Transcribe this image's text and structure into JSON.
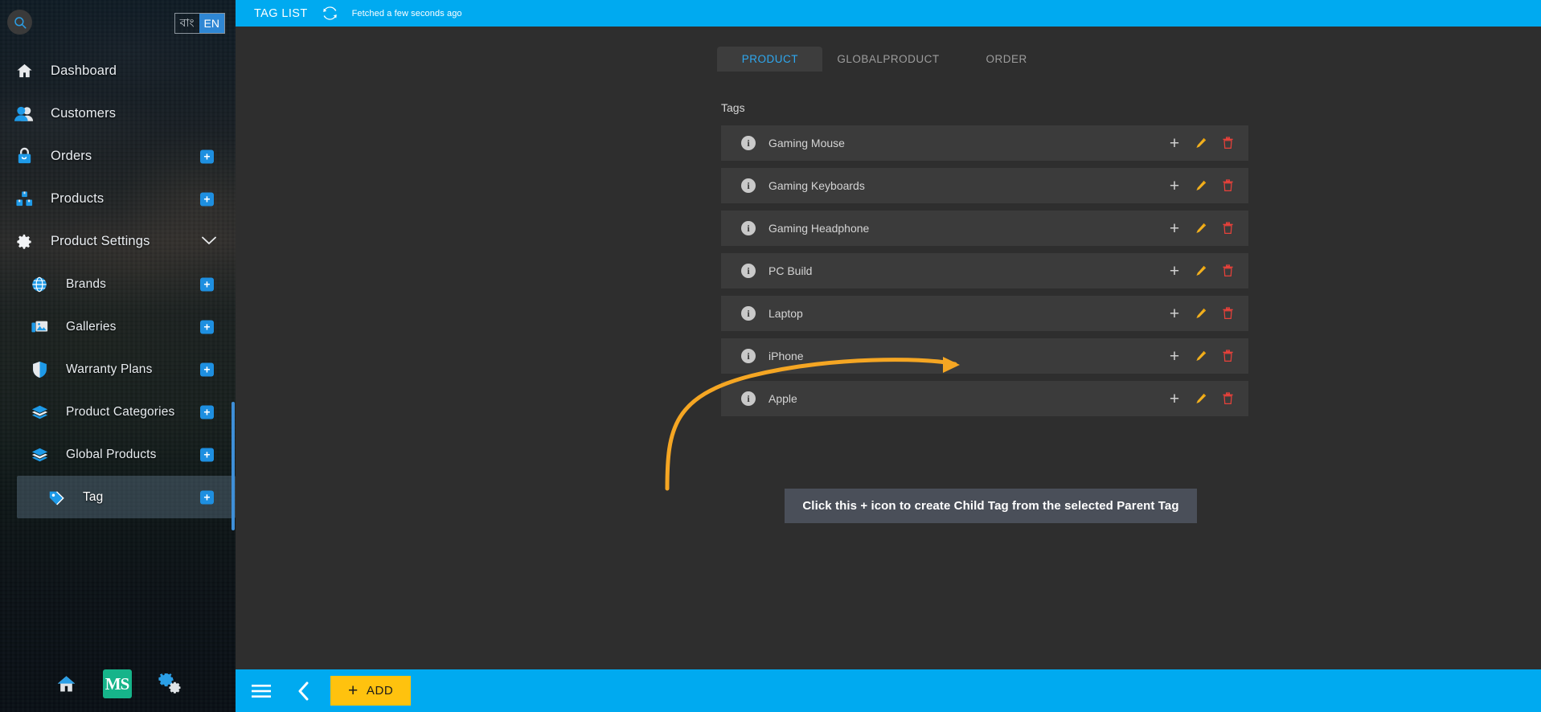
{
  "sidebar": {
    "search_icon": "search-icon",
    "language": {
      "options": [
        {
          "label": "বাং",
          "active": false
        },
        {
          "label": "EN",
          "active": true
        }
      ]
    },
    "items": [
      {
        "label": "Dashboard",
        "icon": "home-icon",
        "sub": false,
        "badge": null,
        "chevron": false,
        "active": false
      },
      {
        "label": "Customers",
        "icon": "users-icon",
        "sub": false,
        "badge": null,
        "chevron": false,
        "active": false
      },
      {
        "label": "Orders",
        "icon": "bag-icon",
        "sub": false,
        "badge": "+",
        "chevron": false,
        "active": false
      },
      {
        "label": "Products",
        "icon": "boxes-icon",
        "sub": false,
        "badge": "+",
        "chevron": false,
        "active": false
      },
      {
        "label": "Product Settings",
        "icon": "gear-icon",
        "sub": false,
        "badge": null,
        "chevron": true,
        "active": false
      },
      {
        "label": "Brands",
        "icon": "globe-icon",
        "sub": true,
        "badge": "+",
        "chevron": false,
        "active": false
      },
      {
        "label": "Galleries",
        "icon": "image-icon",
        "sub": true,
        "badge": "+",
        "chevron": false,
        "active": false
      },
      {
        "label": "Warranty Plans",
        "icon": "shield-icon",
        "sub": true,
        "badge": "+",
        "chevron": false,
        "active": false
      },
      {
        "label": "Product Categories",
        "icon": "layers-icon",
        "sub": true,
        "badge": "+",
        "chevron": false,
        "active": false
      },
      {
        "label": "Global Products",
        "icon": "layers-icon",
        "sub": true,
        "badge": "+",
        "chevron": false,
        "active": false
      },
      {
        "label": "Tag",
        "icon": "tag-icon",
        "sub": true,
        "badge": "+",
        "chevron": false,
        "active": true
      }
    ],
    "bottom_buttons": [
      {
        "name": "home-icon",
        "label": ""
      },
      {
        "name": "ms-logo",
        "label": "MS"
      },
      {
        "name": "settings-icon",
        "label": ""
      }
    ]
  },
  "header": {
    "title": "TAG LIST",
    "refresh_icon": "refresh-icon",
    "fetched_text": "Fetched a few seconds ago"
  },
  "tabs": [
    {
      "label": "PRODUCT",
      "active": true
    },
    {
      "label": "GLOBALPRODUCT",
      "active": false
    },
    {
      "label": "ORDER",
      "active": false
    }
  ],
  "panel": {
    "title": "Tags",
    "row_actions": [
      {
        "name": "add-child-tag-icon",
        "glyph": "+",
        "color": "#cfcfcf"
      },
      {
        "name": "edit-icon",
        "glyph": "✏",
        "color": "#f2b01e"
      },
      {
        "name": "delete-icon",
        "glyph": "🗑",
        "color": "#e8413a"
      }
    ],
    "tags": [
      {
        "name": "Gaming Mouse"
      },
      {
        "name": "Gaming Keyboards"
      },
      {
        "name": "Gaming Headphone"
      },
      {
        "name": "PC Build"
      },
      {
        "name": "Laptop"
      },
      {
        "name": "iPhone"
      },
      {
        "name": "Apple"
      }
    ]
  },
  "callout": {
    "text": "Click this + icon to create Child Tag from the selected Parent Tag",
    "arrow_color": "#f5a623"
  },
  "bottombar": {
    "menu_icon": "hamburger-menu-icon",
    "back_icon": "chevron-left-icon",
    "add_label": "ADD",
    "add_plus": "+"
  },
  "colors": {
    "accent_blue": "#00aaf0",
    "accent_yellow": "#ffc20e",
    "tab_active": "#2ea8f0",
    "row_bg": "#3b3b3b",
    "page_bg": "#2e2e2e"
  }
}
